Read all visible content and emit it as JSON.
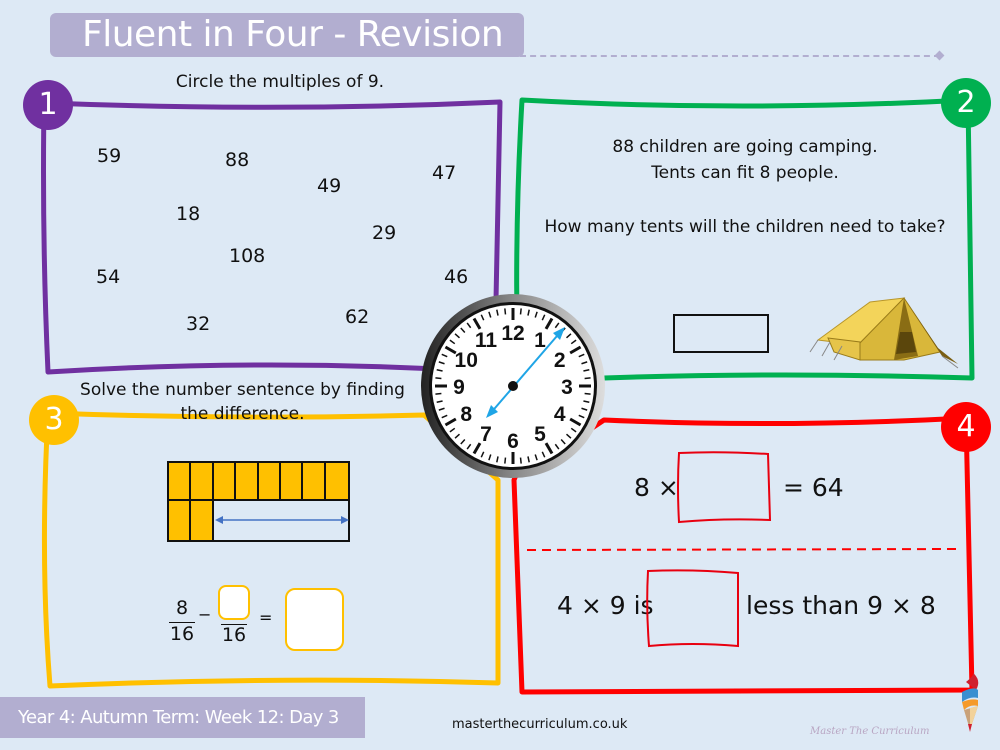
{
  "header": {
    "title": "Fluent in Four - Revision"
  },
  "q1": {
    "badge": "1",
    "color": "#7030a0",
    "instruction": "Circle the multiples of 9.",
    "numbers": [
      "59",
      "88",
      "49",
      "47",
      "18",
      "29",
      "108",
      "54",
      "46",
      "32",
      "62"
    ]
  },
  "q2": {
    "badge": "2",
    "color": "#00b050",
    "line1": "88 children are going camping.",
    "line2": "Tents can fit 8 people.",
    "question": "How many tents will the children need to take?",
    "image": "tent-illustration"
  },
  "q3": {
    "badge": "3",
    "color": "#ffc000",
    "instruction_line1": "Solve the number sentence by finding",
    "instruction_line2": "the difference.",
    "bar_model": {
      "total_parts": 16,
      "shaded_parts": 10,
      "row1_shaded": 8,
      "row2_shaded": 2
    },
    "frac1_num": "8",
    "frac1_den": "16",
    "minus": "−",
    "frac2_den": "16",
    "equals": "="
  },
  "q4": {
    "badge": "4",
    "color": "#ff0000",
    "eq1_left": "8 ×",
    "eq1_right": "= 64",
    "eq2_left": "4 × 9 is",
    "eq2_right": "less than 9 × 8"
  },
  "clock": {
    "icon": "clock-face",
    "numerals": [
      "12",
      "1",
      "2",
      "3",
      "4",
      "5",
      "6",
      "7",
      "8",
      "9",
      "10",
      "11"
    ],
    "hand_color": "#1fa5e6"
  },
  "footer": {
    "label": "Year 4: Autumn Term: Week 12: Day 3",
    "website": "masterthecurriculum.co.uk",
    "brand": "Master The Curriculum"
  }
}
